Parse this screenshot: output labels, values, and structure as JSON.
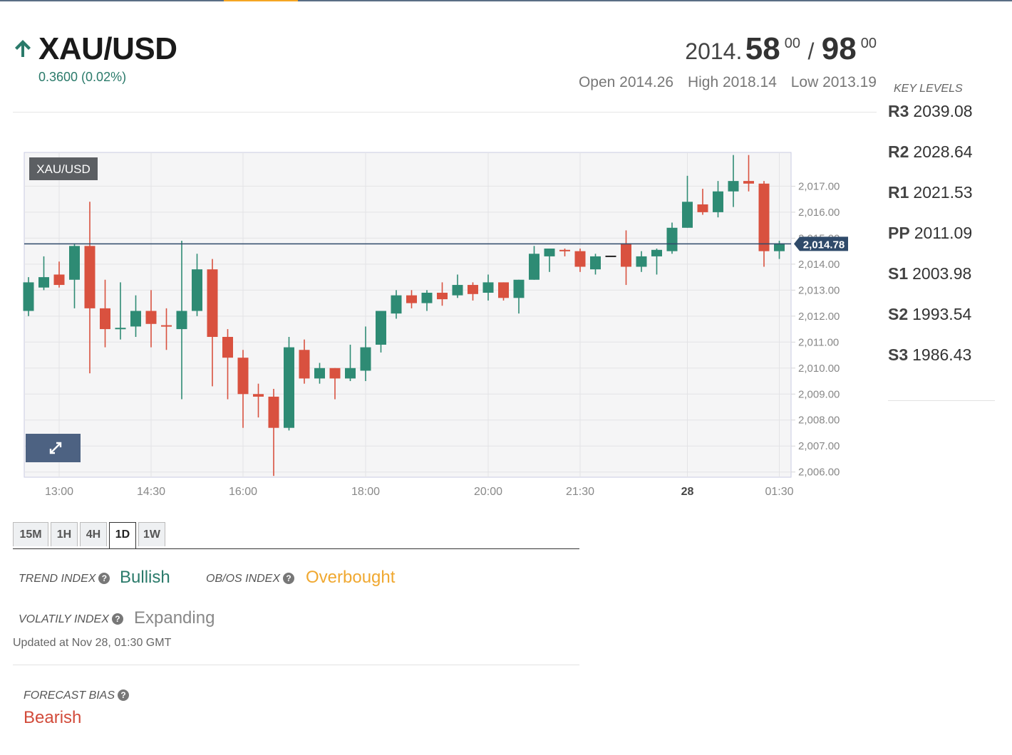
{
  "header": {
    "symbol": "XAU/USD",
    "change": "0.3600 (0.02%)",
    "bid_prefix": "2014.",
    "bid_big": "58",
    "bid_sup": "00",
    "slash": "/",
    "ask_big": "98",
    "ask_sup": "00",
    "open": "Open 2014.26",
    "high": "High 2018.14",
    "low": "Low 2013.19",
    "trend_icon": "up-arrow-icon",
    "up_color": "#2a7a6a"
  },
  "key_levels": {
    "title": "KEY LEVELS",
    "levels": [
      {
        "name": "R3",
        "value": "2039.08"
      },
      {
        "name": "R2",
        "value": "2028.64"
      },
      {
        "name": "R1",
        "value": "2021.53"
      },
      {
        "name": "PP",
        "value": "2011.09"
      },
      {
        "name": "S1",
        "value": "2003.98"
      },
      {
        "name": "S2",
        "value": "1993.54"
      },
      {
        "name": "S3",
        "value": "1986.43"
      }
    ]
  },
  "chart_data": {
    "type": "candlestick",
    "symbol_label": "XAU/USD",
    "current_price": 2014.78,
    "current_price_label": "2,014.78",
    "ylim": [
      2005.8,
      2018.3
    ],
    "y_ticks": [
      {
        "value": 2017,
        "label": "2,017.00"
      },
      {
        "value": 2016,
        "label": "2,016.00"
      },
      {
        "value": 2015,
        "label": "2,015.00"
      },
      {
        "value": 2014,
        "label": "2,014.00"
      },
      {
        "value": 2013,
        "label": "2,013.00"
      },
      {
        "value": 2012,
        "label": "2,012.00"
      },
      {
        "value": 2011,
        "label": "2,011.00"
      },
      {
        "value": 2010,
        "label": "2,010.00"
      },
      {
        "value": 2009,
        "label": "2,009.00"
      },
      {
        "value": 2008,
        "label": "2,008.00"
      },
      {
        "value": 2007,
        "label": "2,007.00"
      },
      {
        "value": 2006,
        "label": "2,006.00"
      }
    ],
    "x_ticks": [
      {
        "index": 2,
        "label": "13:00",
        "bold": false
      },
      {
        "index": 8,
        "label": "14:30",
        "bold": false
      },
      {
        "index": 14,
        "label": "16:00",
        "bold": false
      },
      {
        "index": 22,
        "label": "18:00",
        "bold": false
      },
      {
        "index": 30,
        "label": "20:00",
        "bold": false
      },
      {
        "index": 36,
        "label": "21:30",
        "bold": false
      },
      {
        "index": 43,
        "label": "28",
        "bold": true
      },
      {
        "index": 49,
        "label": "01:30",
        "bold": false
      }
    ],
    "up_color": "#2e8b74",
    "down_color": "#d9513f",
    "candles": [
      {
        "o": 2012.2,
        "h": 2013.5,
        "l": 2012.0,
        "c": 2013.3
      },
      {
        "o": 2013.1,
        "h": 2014.3,
        "l": 2013.0,
        "c": 2013.5
      },
      {
        "o": 2013.6,
        "h": 2014.1,
        "l": 2013.1,
        "c": 2013.2
      },
      {
        "o": 2013.4,
        "h": 2014.8,
        "l": 2012.3,
        "c": 2014.7
      },
      {
        "o": 2014.7,
        "h": 2016.4,
        "l": 2009.8,
        "c": 2012.3
      },
      {
        "o": 2012.3,
        "h": 2013.4,
        "l": 2010.8,
        "c": 2011.5
      },
      {
        "o": 2011.5,
        "h": 2013.3,
        "l": 2011.1,
        "c": 2011.55
      },
      {
        "o": 2011.6,
        "h": 2012.8,
        "l": 2011.2,
        "c": 2012.2
      },
      {
        "o": 2012.2,
        "h": 2013.0,
        "l": 2010.8,
        "c": 2011.7
      },
      {
        "o": 2011.65,
        "h": 2012.3,
        "l": 2010.7,
        "c": 2011.6
      },
      {
        "o": 2011.5,
        "h": 2014.9,
        "l": 2008.8,
        "c": 2012.2
      },
      {
        "o": 2012.2,
        "h": 2014.4,
        "l": 2012.0,
        "c": 2013.8
      },
      {
        "o": 2013.8,
        "h": 2014.2,
        "l": 2009.3,
        "c": 2011.2
      },
      {
        "o": 2011.2,
        "h": 2011.5,
        "l": 2008.8,
        "c": 2010.4
      },
      {
        "o": 2010.4,
        "h": 2010.7,
        "l": 2007.7,
        "c": 2009.0
      },
      {
        "o": 2009.0,
        "h": 2009.4,
        "l": 2008.1,
        "c": 2008.9
      },
      {
        "o": 2008.9,
        "h": 2009.2,
        "l": 2005.85,
        "c": 2007.7
      },
      {
        "o": 2007.7,
        "h": 2011.2,
        "l": 2007.6,
        "c": 2010.8
      },
      {
        "o": 2010.7,
        "h": 2011.1,
        "l": 2009.4,
        "c": 2009.6
      },
      {
        "o": 2009.6,
        "h": 2010.2,
        "l": 2009.4,
        "c": 2010.0
      },
      {
        "o": 2010.0,
        "h": 2010.0,
        "l": 2008.8,
        "c": 2009.6
      },
      {
        "o": 2009.6,
        "h": 2010.9,
        "l": 2009.5,
        "c": 2010.0
      },
      {
        "o": 2009.9,
        "h": 2011.6,
        "l": 2009.5,
        "c": 2010.8
      },
      {
        "o": 2010.9,
        "h": 2012.2,
        "l": 2010.6,
        "c": 2012.2
      },
      {
        "o": 2012.1,
        "h": 2013.0,
        "l": 2011.9,
        "c": 2012.8
      },
      {
        "o": 2012.8,
        "h": 2013.0,
        "l": 2012.3,
        "c": 2012.5
      },
      {
        "o": 2012.5,
        "h": 2013.0,
        "l": 2012.2,
        "c": 2012.9
      },
      {
        "o": 2012.9,
        "h": 2013.3,
        "l": 2012.4,
        "c": 2012.65
      },
      {
        "o": 2012.8,
        "h": 2013.6,
        "l": 2012.7,
        "c": 2013.2
      },
      {
        "o": 2013.2,
        "h": 2013.3,
        "l": 2012.6,
        "c": 2012.85
      },
      {
        "o": 2012.9,
        "h": 2013.6,
        "l": 2012.6,
        "c": 2013.3
      },
      {
        "o": 2013.3,
        "h": 2013.3,
        "l": 2012.6,
        "c": 2012.7
      },
      {
        "o": 2012.7,
        "h": 2013.4,
        "l": 2012.1,
        "c": 2013.4
      },
      {
        "o": 2013.4,
        "h": 2014.7,
        "l": 2013.4,
        "c": 2014.4
      },
      {
        "o": 2014.3,
        "h": 2014.6,
        "l": 2013.7,
        "c": 2014.6
      },
      {
        "o": 2014.55,
        "h": 2014.6,
        "l": 2014.3,
        "c": 2014.5
      },
      {
        "o": 2014.5,
        "h": 2014.6,
        "l": 2013.7,
        "c": 2013.9
      },
      {
        "o": 2013.8,
        "h": 2014.4,
        "l": 2013.6,
        "c": 2014.3
      },
      {
        "o": 2014.3,
        "h": 2014.3,
        "l": 2014.3,
        "c": 2014.3
      },
      {
        "o": 2014.8,
        "h": 2015.3,
        "l": 2013.2,
        "c": 2013.9
      },
      {
        "o": 2013.9,
        "h": 2014.5,
        "l": 2013.7,
        "c": 2014.3
      },
      {
        "o": 2014.3,
        "h": 2014.6,
        "l": 2013.6,
        "c": 2014.55
      },
      {
        "o": 2014.5,
        "h": 2015.6,
        "l": 2014.4,
        "c": 2015.4
      },
      {
        "o": 2015.4,
        "h": 2017.4,
        "l": 2015.4,
        "c": 2016.4
      },
      {
        "o": 2016.3,
        "h": 2016.9,
        "l": 2015.9,
        "c": 2016.0
      },
      {
        "o": 2016.0,
        "h": 2017.2,
        "l": 2015.8,
        "c": 2016.8
      },
      {
        "o": 2016.8,
        "h": 2018.2,
        "l": 2016.2,
        "c": 2017.2
      },
      {
        "o": 2017.2,
        "h": 2018.2,
        "l": 2016.8,
        "c": 2017.1
      },
      {
        "o": 2017.1,
        "h": 2017.2,
        "l": 2013.9,
        "c": 2014.5
      },
      {
        "o": 2014.5,
        "h": 2014.9,
        "l": 2014.2,
        "c": 2014.8
      }
    ]
  },
  "timeframes": {
    "active": "1D",
    "items": [
      "15M",
      "1H",
      "4H",
      "1D",
      "1W"
    ]
  },
  "indices": {
    "trend_label": "TREND INDEX",
    "trend_value": "Bullish",
    "trend_color": "#2a7a6a",
    "obos_label": "OB/OS INDEX",
    "obos_value": "Overbought",
    "obos_color": "#f0a830",
    "volatility_label": "VOLATILY INDEX",
    "volatility_value": "Expanding",
    "volatility_color": "#888888",
    "help_icon": "question-circle-icon",
    "updated": "Updated at Nov 28, 01:30 GMT"
  },
  "forecast": {
    "label": "FORECAST BIAS",
    "value": "Bearish",
    "color": "#d24b3a"
  }
}
